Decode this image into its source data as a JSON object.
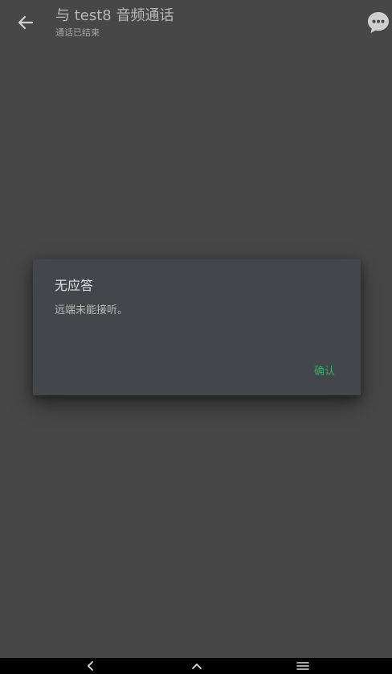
{
  "appbar": {
    "back_icon": "arrow-left-icon",
    "title": "与 test8 音频通话",
    "subtitle": "通话已结束",
    "chat_icon": "chat-bubble-icon"
  },
  "dialog": {
    "title": "无应答",
    "message": "远端未能接听。",
    "confirm_label": "确认",
    "accent_color": "#26b36b"
  },
  "navbar": {
    "back_icon": "chevron-left-icon",
    "home_icon": "chevron-up-icon",
    "menu_icon": "menu-icon"
  },
  "colors": {
    "background": "#474747",
    "dialog_background": "#43464a",
    "navbar_background": "#000000"
  }
}
